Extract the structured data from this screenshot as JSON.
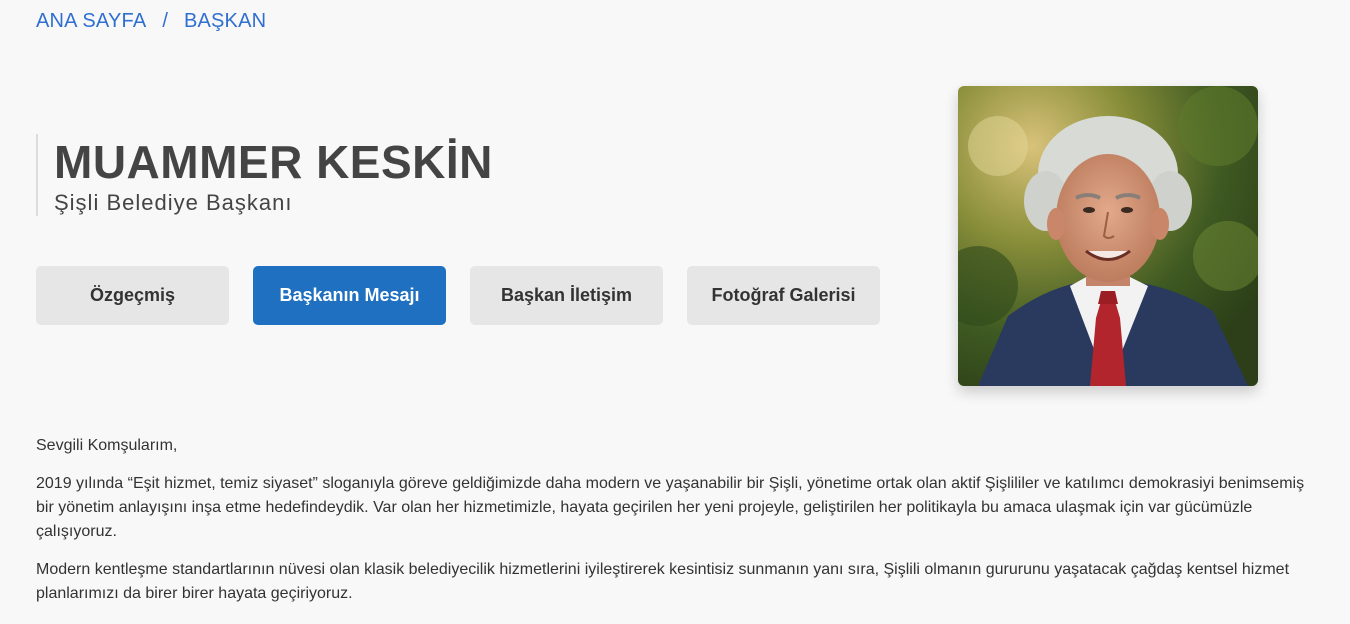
{
  "breadcrumb": {
    "home": "ANA SAYFA",
    "separator": "/",
    "current": "BAŞKAN"
  },
  "header": {
    "name": "MUAMMER KESKİN",
    "role": "Şişli Belediye Başkanı"
  },
  "tabs": [
    {
      "label": "Özgeçmiş",
      "active": false
    },
    {
      "label": "Başkanın Mesajı",
      "active": true
    },
    {
      "label": "Başkan İletişim",
      "active": false
    },
    {
      "label": "Fotoğraf Galerisi",
      "active": false
    }
  ],
  "photo": {
    "icon": "portrait-photo"
  },
  "message": {
    "greeting": "Sevgili Komşularım,",
    "paragraph1": "2019 yılında “Eşit hizmet, temiz siyaset” sloganıyla göreve geldiğimizde daha modern ve yaşanabilir bir Şişli, yönetime ortak olan aktif Şişlililer ve katılımcı demokrasiyi benimsemiş bir yönetim anlayışını inşa etme hedefindeydik. Var olan her hizmetimizle, hayata geçirilen her yeni projeyle, geliştirilen her politikayla bu amaca ulaşmak için var gücümüzle çalışıyoruz.",
    "paragraph2": "Modern kentleşme standartlarının nüvesi olan klasik belediyecilik hizmetlerini iyileştirerek kesintisiz sunmanın yanı sıra, Şişlili olmanın gururunu yaşatacak çağdaş kentsel hizmet planlarımızı da birer birer hayata geçiriyoruz."
  },
  "colors": {
    "accent": "#1f70c1",
    "link": "#2f6fd1",
    "tab_bg": "#e6e6e6",
    "page_bg": "#f8f8f8"
  }
}
